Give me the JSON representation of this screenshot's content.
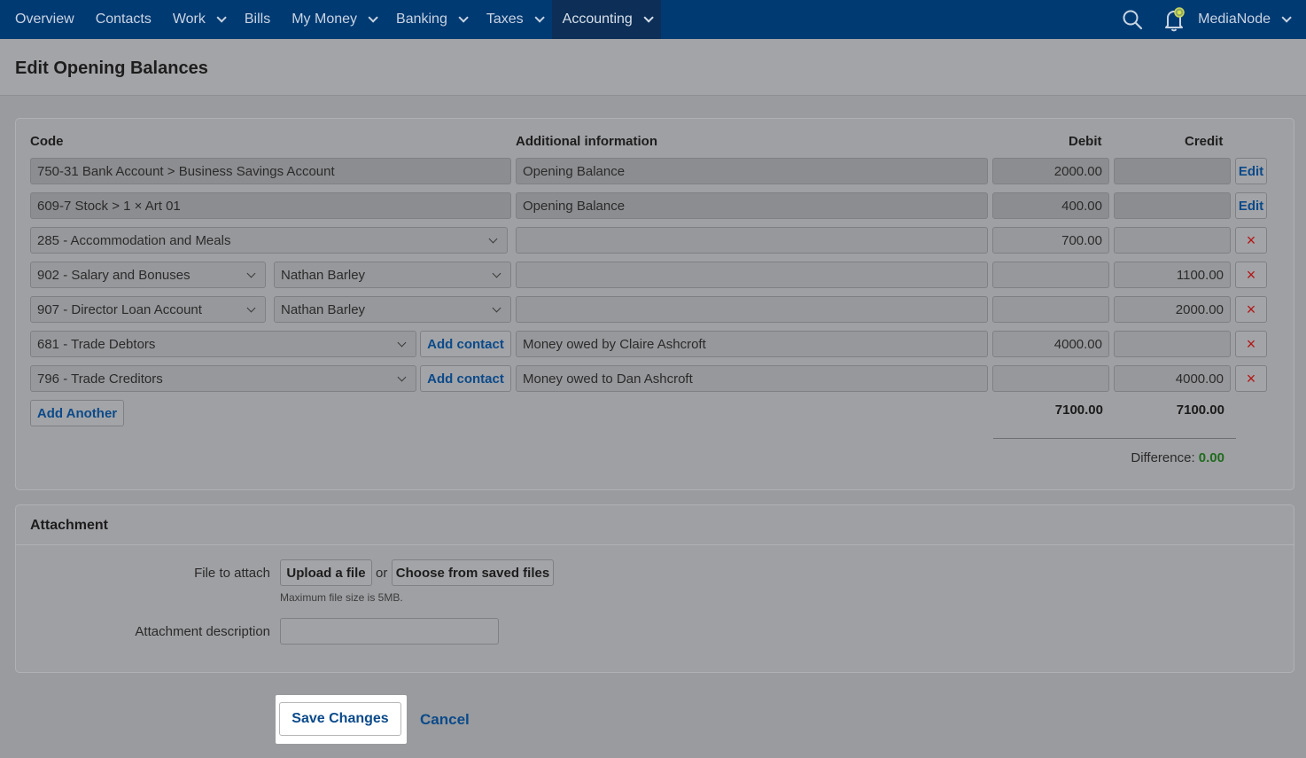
{
  "nav": {
    "items": [
      {
        "label": "Overview",
        "dropdown": false
      },
      {
        "label": "Contacts",
        "dropdown": false
      },
      {
        "label": "Work",
        "dropdown": true
      },
      {
        "label": "Bills",
        "dropdown": false
      },
      {
        "label": "My Money",
        "dropdown": true
      },
      {
        "label": "Banking",
        "dropdown": true
      },
      {
        "label": "Taxes",
        "dropdown": true
      },
      {
        "label": "Accounting",
        "dropdown": true
      }
    ],
    "active": "Accounting",
    "account_name": "MediaNode",
    "icons": [
      "search-icon",
      "notification-bell-icon"
    ]
  },
  "page": {
    "title": "Edit Opening Balances"
  },
  "balances": {
    "headers": {
      "code": "Code",
      "info": "Additional information",
      "debit": "Debit",
      "credit": "Credit"
    },
    "rows": [
      {
        "code": "750-31 Bank Account  >  Business Savings Account",
        "info": "Opening Balance",
        "debit": "2000.00",
        "credit": "",
        "action": "Edit"
      },
      {
        "code": "609-7 Stock  >  1 × Art 01",
        "info": "Opening Balance",
        "debit": "400.00",
        "credit": "",
        "action": "Edit"
      },
      {
        "code": "285 - Accommodation and Meals",
        "info": "",
        "debit": "700.00",
        "credit": "",
        "action": "×"
      },
      {
        "code": "902 - Salary and Bonuses",
        "contact": "Nathan Barley",
        "info": "",
        "debit": "",
        "credit": "1100.00",
        "action": "×"
      },
      {
        "code": "907 - Director Loan Account",
        "contact": "Nathan Barley",
        "info": "",
        "debit": "",
        "credit": "2000.00",
        "action": "×"
      },
      {
        "code": "681 - Trade Debtors",
        "add_contact": "Add contact",
        "info": "Money owed by Claire Ashcroft",
        "debit": "4000.00",
        "credit": "",
        "action": "×"
      },
      {
        "code": "796 - Trade Creditors",
        "add_contact": "Add contact",
        "info": "Money owed to Dan Ashcroft",
        "debit": "",
        "credit": "4000.00",
        "action": "×"
      }
    ],
    "add_another": "Add Another",
    "total_debit": "7100.00",
    "total_credit": "7100.00",
    "difference_label": "Difference:",
    "difference_value": "0.00",
    "difference_color": "#1f6b1f"
  },
  "attachment": {
    "heading": "Attachment",
    "file_label": "File to attach",
    "upload_label": "Upload a file",
    "or_label": "or",
    "saved_files_label": "Choose from saved files",
    "hint": "Maximum file size is 5MB.",
    "description_label": "Attachment description",
    "description_value": ""
  },
  "actions": {
    "save": "Save Changes",
    "cancel": "Cancel"
  },
  "colors": {
    "nav_bg": "#003a73",
    "link": "#0b4a8a",
    "delete": "#b31515"
  }
}
